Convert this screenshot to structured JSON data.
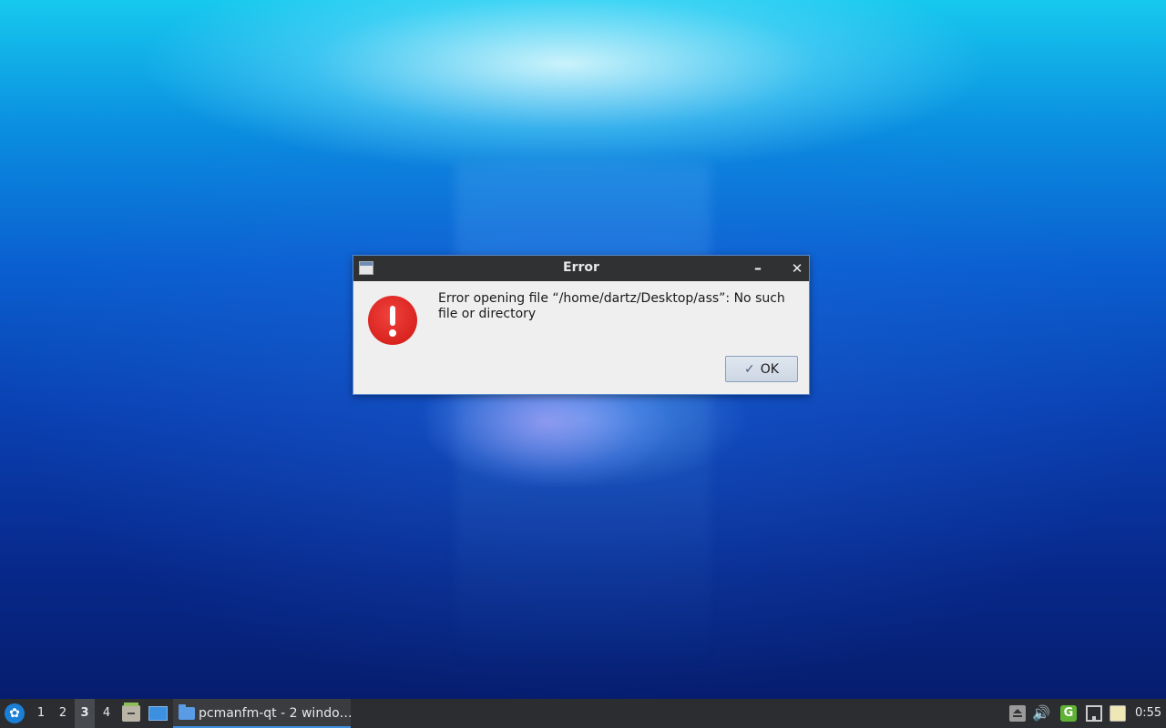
{
  "dialog": {
    "title": "Error",
    "minimize_label": "–",
    "close_label": "✕",
    "message": "Error opening file “/home/dartz/Desktop/ass”: No such file or directory",
    "ok_label": "OK",
    "icon": "error-icon"
  },
  "taskbar": {
    "menu_icon": "lxqt-menu-icon",
    "workspaces": [
      "1",
      "2",
      "3",
      "4"
    ],
    "active_workspace": "3",
    "quicklaunch": [
      "file-manager-icon",
      "show-desktop-icon"
    ],
    "task_label": "pcmanfm-qt - 2 windo…",
    "tray": [
      "eject-icon",
      "volume-icon",
      "network-manager-icon",
      "wired-network-icon",
      "clipboard-icon"
    ],
    "volume_glyph": "🔊",
    "network_glyph": "G",
    "clock": "0:55"
  },
  "colors": {
    "accent": "#3d8fe0",
    "error_red": "#d9231f",
    "titlebar": "#2f3133",
    "taskbar": "#2b2d30"
  }
}
